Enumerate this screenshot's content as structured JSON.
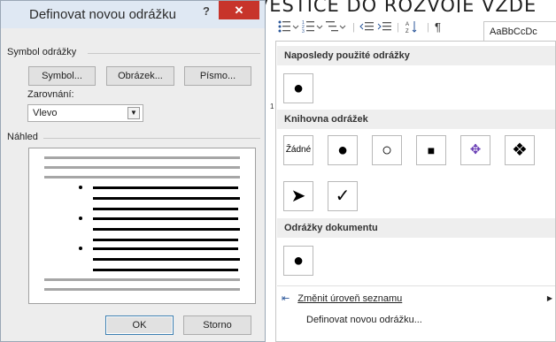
{
  "background_caption": "INVESTICE DO ROZVOJE VZDĚ",
  "dialog": {
    "title": "Definovat novou odrážku",
    "help_icon": "?",
    "close_icon": "✕",
    "symbol_group_label": "Symbol odrážky",
    "symbol_button": "Symbol...",
    "picture_button": "Obrázek...",
    "font_button": "Písmo...",
    "alignment_label": "Zarovnání:",
    "alignment_value": "Vlevo",
    "preview_label": "Náhled",
    "ok_button": "OK",
    "cancel_button": "Storno"
  },
  "ribbon": {
    "bullets_icon": "bullet-list-icon",
    "numbering_icon": "numbered-list-icon",
    "multilevel_icon": "multilevel-list-icon",
    "decrease_indent_icon": "decrease-indent-icon",
    "increase_indent_icon": "increase-indent-icon",
    "sort_icon": "sort-icon",
    "pilcrow": "¶",
    "style_preview": "AaBbCcDc"
  },
  "gallery": {
    "recent_header": "Naposledy použité odrážky",
    "recent": [
      "●"
    ],
    "library_header": "Knihovna odrážek",
    "library": [
      "Žádné",
      "●",
      "○",
      "■",
      "✥",
      "❖",
      "➤",
      "✓"
    ],
    "document_header": "Odrážky dokumentu",
    "document": [
      "●"
    ],
    "change_level": "Změnit úroveň seznamu",
    "define_new": "Definovat novou odrážku..."
  },
  "ruler_number": "1",
  "colors": {
    "close_red": "#c7342b",
    "title_bar": "#dfe8f3",
    "section_header": "#eeeeee"
  }
}
